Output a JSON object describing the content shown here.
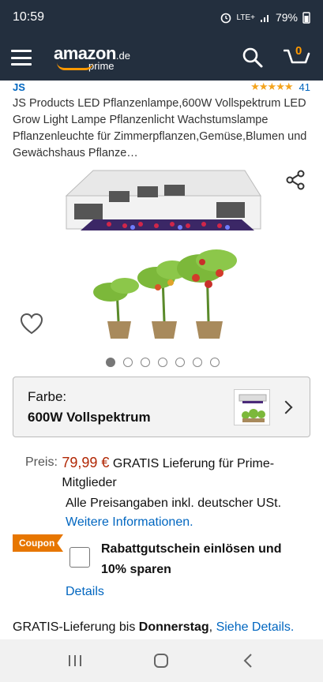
{
  "status_bar": {
    "time": "10:59",
    "network": "LTE+",
    "battery": "79%"
  },
  "header": {
    "logo_text": "amazon",
    "logo_domain": ".de",
    "logo_sub": "prime",
    "cart_count": "0"
  },
  "product": {
    "brand": "JS",
    "rating_stars": "★★★★★",
    "rating_value": 4.5,
    "rating_count": "41",
    "title": "JS Products LED Pflanzenlampe,600W Vollspektrum LED Grow Light Lampe Pflanzenlicht Wachstumslampe Pflanzenleuchte für Zimmerpflanzen,Gemüse,Blumen und Gewächshaus Pflanze…",
    "image_count": 7,
    "active_image": 0
  },
  "variant": {
    "label": "Farbe:",
    "value": "600W Vollspektrum"
  },
  "price": {
    "label": "Preis:",
    "amount": "79,99 €",
    "shipping": "GRATIS Lieferung für Prime-Mitglieder",
    "vat_note": "Alle Preisangaben inkl. deutscher USt.",
    "more_info_link": "Weitere Informationen."
  },
  "coupon": {
    "badge": "Coupon",
    "text": "Rabattgutschein einlösen und 10% sparen",
    "details_link": "Details"
  },
  "delivery": {
    "prefix": "GRATIS-Lieferung bis ",
    "day": "Donnerstag",
    "separator": ", ",
    "link": "Siehe Details."
  },
  "colors": {
    "header_bg": "#232f3e",
    "link": "#0066c0",
    "price": "#b12704",
    "coupon": "#e77600",
    "stars": "#f4a41d"
  }
}
